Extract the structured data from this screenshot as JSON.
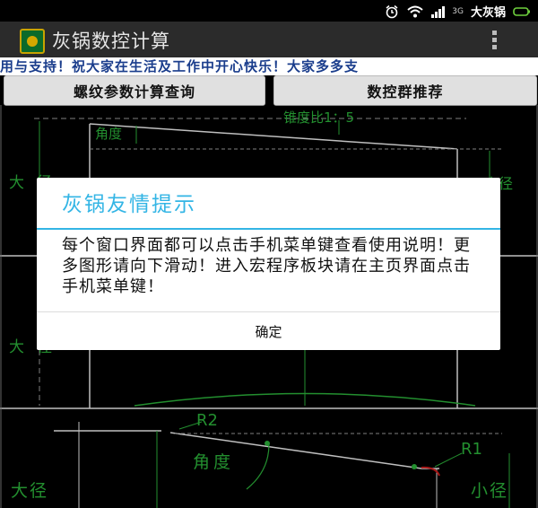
{
  "status": {
    "carrier": "大灰锅",
    "net": "3G"
  },
  "app": {
    "title": "灰锅数控计算"
  },
  "marquee": {
    "text": "用与支持！祝大家在生活及工作中开心快乐！大家多多支"
  },
  "buttons": {
    "thread_query": "螺纹参数计算查询",
    "cnc_group": "数控群推荐"
  },
  "diagram": {
    "taper_ratio": "锥度比1：5",
    "angle": "角度",
    "major_dia": "大径",
    "minor_dia": "小径",
    "r2": "R2",
    "r1": "R1"
  },
  "dialog": {
    "title": "灰锅友情提示",
    "message": "每个窗口界面都可以点击手机菜单键查看使用说明！更多图形请向下滑动！进入宏程序板块请在主页界面点击手机菜单键！",
    "ok": "确定"
  },
  "colors": {
    "accent": "#33b5e5",
    "line": "#ffffff",
    "dim": "#2fbf3f",
    "marquee_text": "#1a3d8c"
  }
}
